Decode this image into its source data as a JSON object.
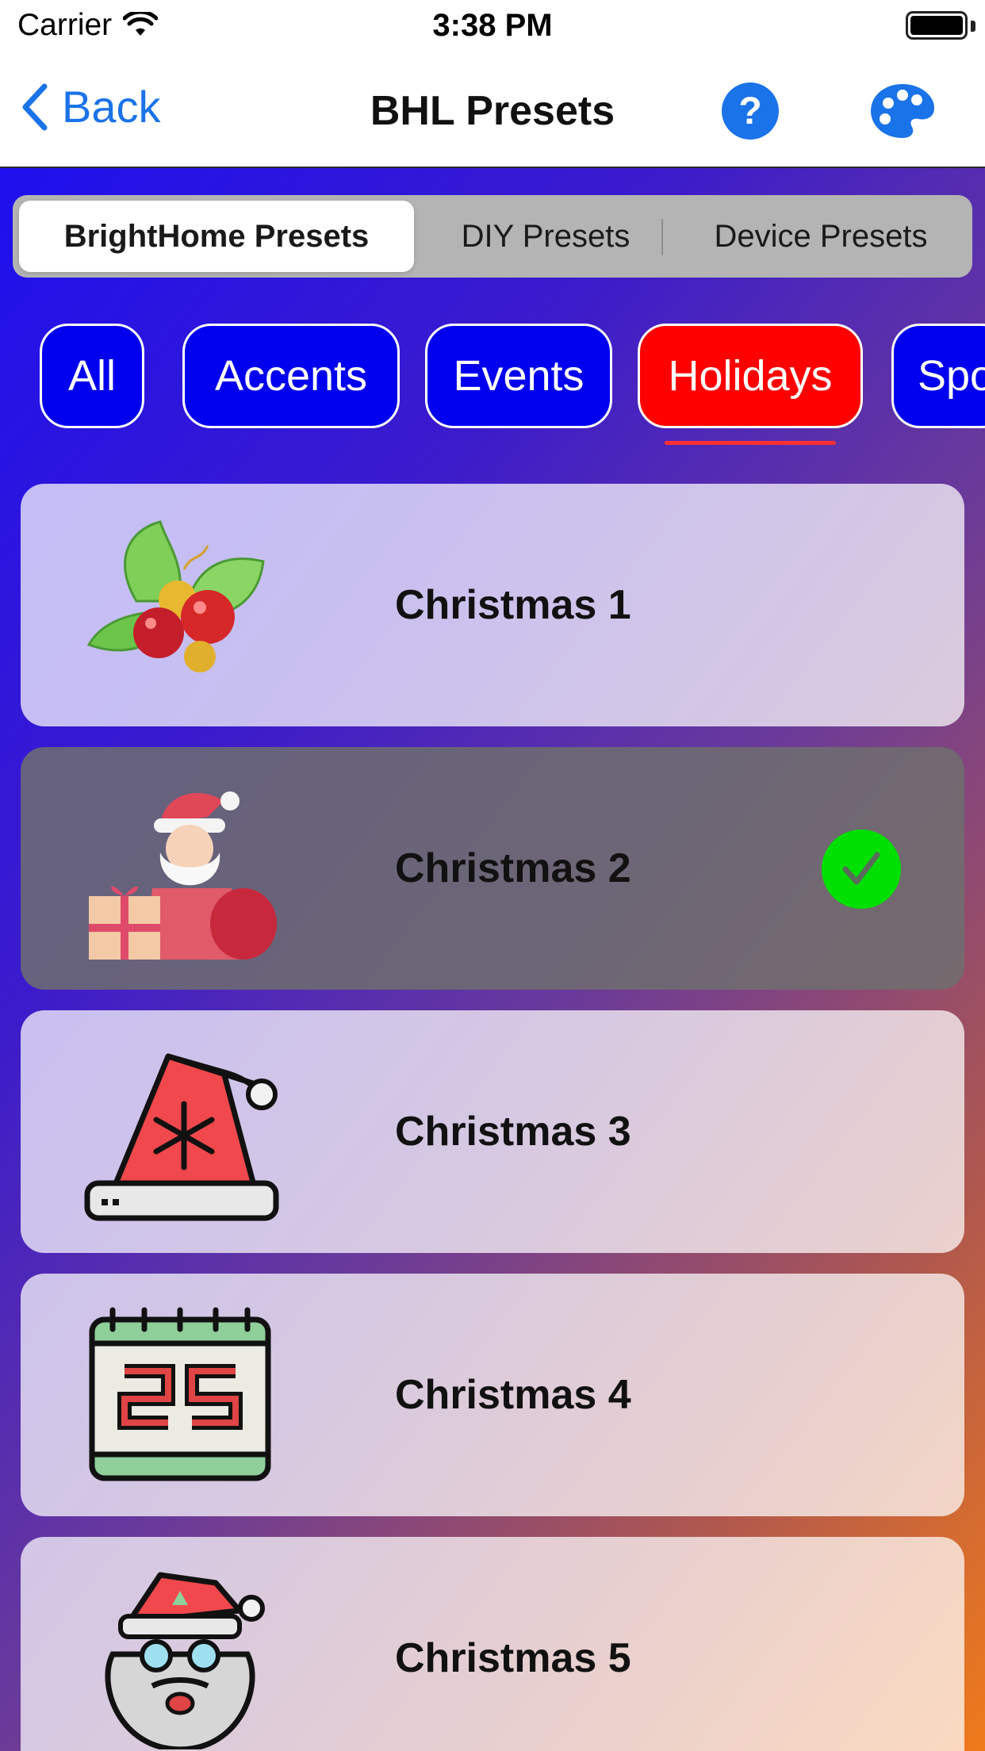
{
  "status_bar": {
    "carrier": "Carrier",
    "time": "3:38 PM"
  },
  "nav": {
    "back_label": "Back",
    "title": "BHL Presets",
    "help_label": "?"
  },
  "segments": [
    {
      "label": "BrightHome Presets",
      "active": true
    },
    {
      "label": "DIY Presets",
      "active": false
    },
    {
      "label": "Device Presets",
      "active": false
    }
  ],
  "categories": [
    {
      "label": "All",
      "active": false
    },
    {
      "label": "Accents",
      "active": false
    },
    {
      "label": "Events",
      "active": false
    },
    {
      "label": "Holidays",
      "active": true
    },
    {
      "label": "Spo",
      "active": false
    }
  ],
  "presets": [
    {
      "title": "Christmas 1",
      "icon": "holly-ornaments-icon",
      "selected": false
    },
    {
      "title": "Christmas 2",
      "icon": "santa-gift-icon",
      "selected": true
    },
    {
      "title": "Christmas 3",
      "icon": "santa-hat-icon",
      "selected": false
    },
    {
      "title": "Christmas 4",
      "icon": "calendar-25-icon",
      "selected": false
    },
    {
      "title": "Christmas 5",
      "icon": "santa-face-icon",
      "selected": false
    }
  ],
  "colors": {
    "accent_blue": "#1a73e8",
    "chip_blue": "#0000ee",
    "chip_active": "#ff0000",
    "check_green": "#00e000"
  }
}
